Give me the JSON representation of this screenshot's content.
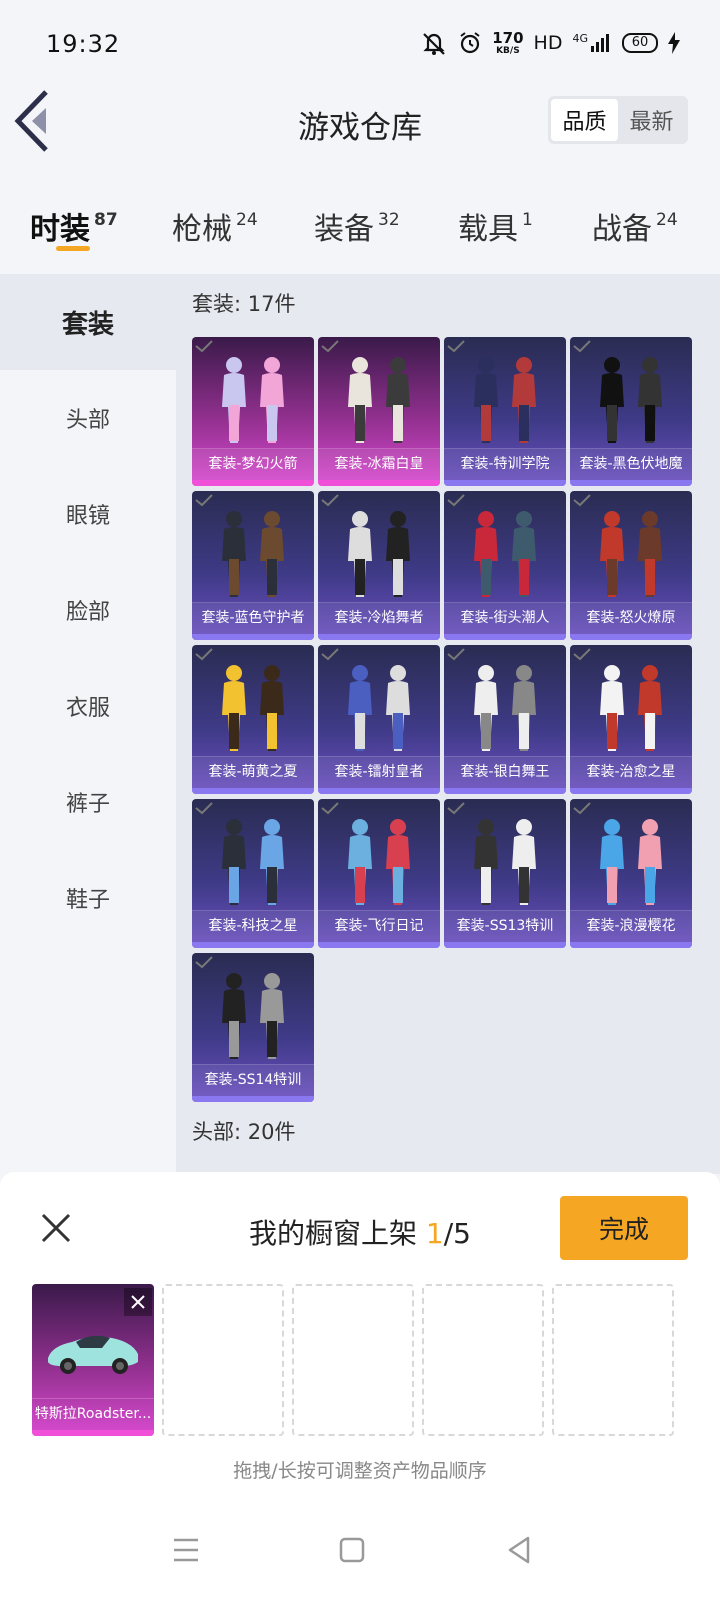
{
  "status_bar": {
    "time": "19:32",
    "net_speed_value": "170",
    "net_speed_unit": "KB/S",
    "hd": "HD",
    "signal": "4G",
    "battery": "60"
  },
  "header": {
    "title": "游戏仓库",
    "sort_options": [
      "品质",
      "最新"
    ],
    "active_sort": "品质"
  },
  "tabs": [
    {
      "label": "时装",
      "count": "87",
      "active": true
    },
    {
      "label": "枪械",
      "count": "24",
      "active": false
    },
    {
      "label": "装备",
      "count": "32",
      "active": false
    },
    {
      "label": "载具",
      "count": "1",
      "active": false
    },
    {
      "label": "战备",
      "count": "24",
      "active": false
    }
  ],
  "sidebar": {
    "items": [
      "套装",
      "头部",
      "眼镜",
      "脸部",
      "衣服",
      "裤子",
      "鞋子"
    ],
    "active": "套装"
  },
  "sections": [
    {
      "label": "套装: 17件"
    },
    {
      "label": "头部: 20件"
    }
  ],
  "items": [
    {
      "name": "套装-梦幻火箭",
      "rarity": "epic"
    },
    {
      "name": "套装-冰霜白皇",
      "rarity": "epic"
    },
    {
      "name": "套装-特训学院",
      "rarity": "rare"
    },
    {
      "name": "套装-黑色伏地魔",
      "rarity": "rare"
    },
    {
      "name": "套装-蓝色守护者",
      "rarity": "rare"
    },
    {
      "name": "套装-冷焰舞者",
      "rarity": "rare"
    },
    {
      "name": "套装-街头潮人",
      "rarity": "rare"
    },
    {
      "name": "套装-怒火燎原",
      "rarity": "rare"
    },
    {
      "name": "套装-萌黄之夏",
      "rarity": "rare"
    },
    {
      "name": "套装-镭射皇者",
      "rarity": "rare"
    },
    {
      "name": "套装-银白舞王",
      "rarity": "rare"
    },
    {
      "name": "套装-治愈之星",
      "rarity": "rare"
    },
    {
      "name": "套装-科技之星",
      "rarity": "rare"
    },
    {
      "name": "套装-飞行日记",
      "rarity": "rare"
    },
    {
      "name": "套装-SS13特训",
      "rarity": "rare"
    },
    {
      "name": "套装-浪漫樱花",
      "rarity": "rare"
    },
    {
      "name": "套装-SS14特训",
      "rarity": "rare"
    }
  ],
  "showcase": {
    "title": "我的橱窗上架",
    "count_current": "1",
    "count_total": "/5",
    "done_label": "完成",
    "slots": [
      {
        "name": "特斯拉Roadster..."
      }
    ],
    "hint": "拖拽/长按可调整资产物品顺序"
  },
  "colors": {
    "accent": "#f5a623",
    "epic": "#d84bd0",
    "rare": "#6b4fc0"
  }
}
